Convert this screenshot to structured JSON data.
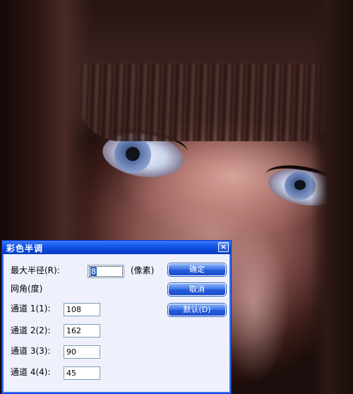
{
  "dialog": {
    "title": "彩色半调",
    "close_glyph": "×",
    "max_radius_label": "最大半径(R):",
    "max_radius_value": "8",
    "units": "(像素)",
    "screen_angles_label": "网角(度)",
    "channels": [
      {
        "label": "通道 1(1):",
        "value": "108"
      },
      {
        "label": "通道 2(2):",
        "value": "162"
      },
      {
        "label": "通道 3(3):",
        "value": "90"
      },
      {
        "label": "通道 4(4):",
        "value": "45"
      }
    ],
    "buttons": {
      "ok": "确定",
      "cancel": "取消",
      "default": "默认(D)"
    }
  }
}
